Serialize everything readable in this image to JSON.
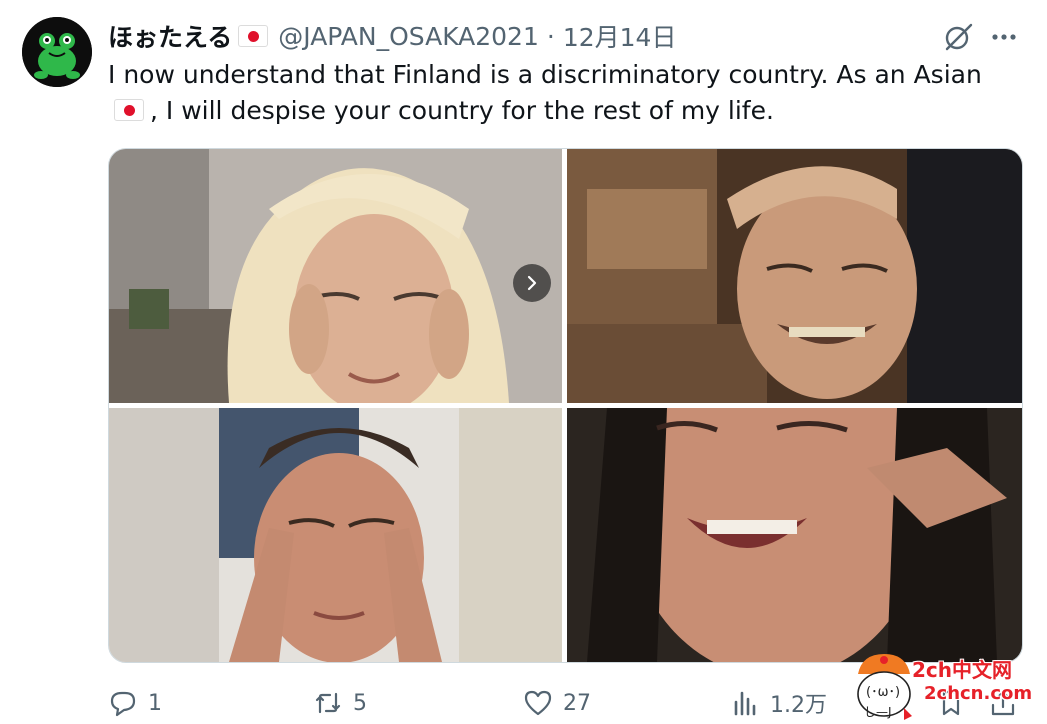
{
  "tweet": {
    "author": {
      "display_name": "ほぉたえる",
      "handle": "@JAPAN_OSAKA2021",
      "avatar": "green-frog-avatar"
    },
    "separator": "·",
    "date": "12月14日",
    "text_part1": "I now understand that Finland is a discriminatory country. As an Asian",
    "text_part2": ", I will despise your country for the rest of my life.",
    "flag_icon": "japan-flag-icon",
    "media": [
      {
        "icon": "photo-blonde-woman-pulling-eyes"
      },
      {
        "icon": "photo-man-hand-on-forehead-grinning"
      },
      {
        "icon": "photo-man-fingers-pulling-eyes"
      },
      {
        "icon": "photo-woman-fingers-pulling-eyes-smiling"
      }
    ]
  },
  "actions": {
    "reply_count": "1",
    "retweet_count": "5",
    "like_count": "27",
    "views_count": "1.2万"
  },
  "watermark": {
    "site_name": "2ch中文网",
    "url": "2chcn.com"
  },
  "colors": {
    "text": "#0f1419",
    "secondary": "#536471",
    "flag_red": "#e0102b",
    "watermark_red": "#e62129"
  }
}
